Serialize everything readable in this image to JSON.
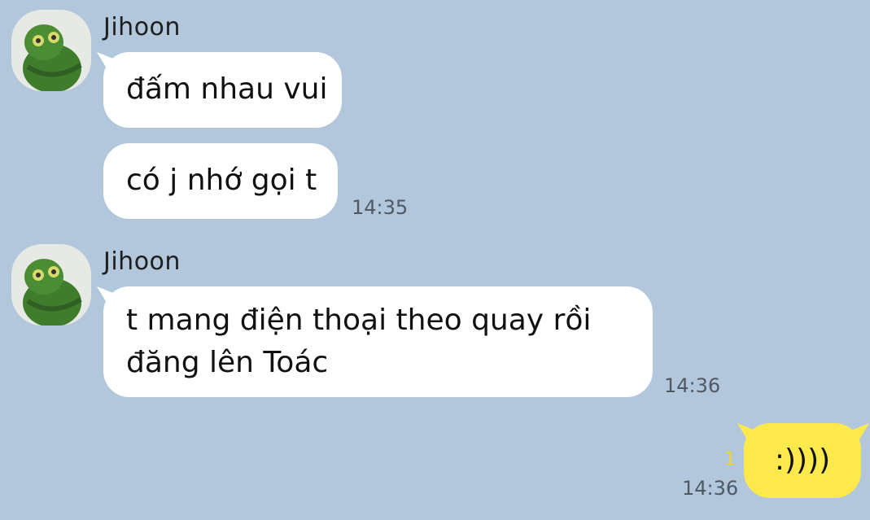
{
  "messages": [
    {
      "sender": "Jihoon",
      "bubbles": [
        {
          "lines": [
            "đấm nhau vui"
          ]
        },
        {
          "lines": [
            "có j nhớ gọi t"
          ],
          "time": "14:35"
        }
      ]
    },
    {
      "sender": "Jihoon",
      "bubbles": [
        {
          "lines": [
            "t mang điện thoại theo quay rồi",
            "đăng lên Toác"
          ],
          "time": "14:36"
        }
      ]
    },
    {
      "sender": "me",
      "bubbles": [
        {
          "lines": [
            ":))))"
          ],
          "time": "14:36",
          "unread": "1"
        }
      ]
    }
  ],
  "colors": {
    "background": "#b2c7dc",
    "incoming_bubble": "#ffffff",
    "outgoing_bubble": "#fde94b",
    "unread_count": "#f2d521"
  }
}
